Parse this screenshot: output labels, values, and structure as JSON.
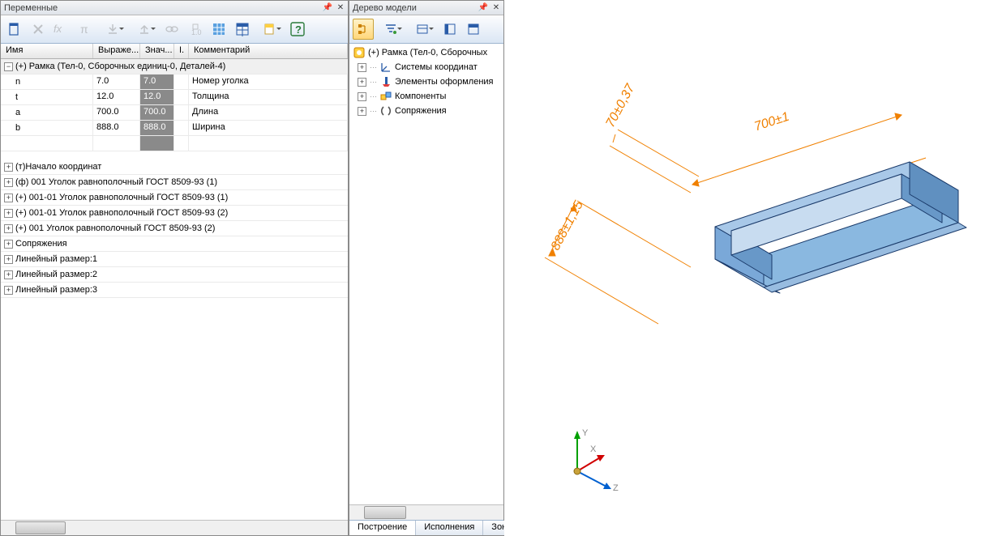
{
  "panels": {
    "left_title": "Переменные",
    "mid_title": "Дерево модели"
  },
  "var_headers": {
    "name": "Имя",
    "expr": "Выраже...",
    "val": "Знач...",
    "i": "I.",
    "comment": "Комментарий"
  },
  "group_row": "(+) Рамка (Тел-0, Сборочных единиц-0, Деталей-4)",
  "vars": [
    {
      "name": "n",
      "expr": "7.0",
      "val": "7.0",
      "comment": "Номер уголка"
    },
    {
      "name": "t",
      "expr": "12.0",
      "val": "12.0",
      "comment": "Толщина"
    },
    {
      "name": "a",
      "expr": "700.0",
      "val": "700.0",
      "comment": "Длина"
    },
    {
      "name": "b",
      "expr": "888.0",
      "val": "888.0",
      "comment": "Ширина"
    }
  ],
  "sub_items": [
    "(т)Начало координат",
    "(ф) 001 Уголок равнополочный ГОСТ 8509-93 (1)",
    "(+) 001-01 Уголок равнополочный ГОСТ 8509-93 (1)",
    "(+) 001-01 Уголок равнополочный ГОСТ 8509-93 (2)",
    "(+) 001 Уголок равнополочный ГОСТ 8509-93 (2)",
    "Сопряжения",
    "Линейный размер:1",
    "Линейный размер:2",
    "Линейный размер:3"
  ],
  "tree": {
    "root": "(+) Рамка (Тел-0, Сборочных",
    "children": [
      "Системы координат",
      "Элементы оформления",
      "Компоненты",
      "Сопряжения"
    ]
  },
  "tabs": [
    "Построение",
    "Исполнения",
    "Зоны"
  ],
  "dims": {
    "top": "70±0,37",
    "right": "700±1",
    "left": "888±1,15"
  },
  "axes": {
    "x": "X",
    "y": "Y",
    "z": "Z"
  }
}
